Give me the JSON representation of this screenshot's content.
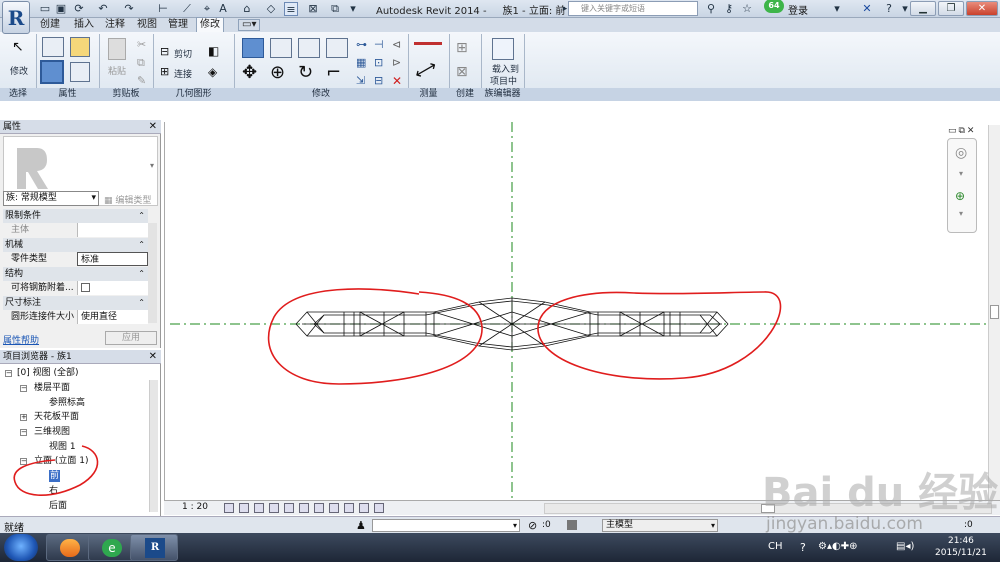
{
  "titlebar": {
    "app_letter": "R",
    "app_title": "Autodesk Revit 2014 -",
    "doc_title": "族1 - 立面: 前",
    "search_placeholder": "键入关键字或短语",
    "badge_count": "64",
    "login": "登录"
  },
  "ribbon": {
    "tabs": [
      {
        "label": "创建",
        "active": false
      },
      {
        "label": "插入",
        "active": false
      },
      {
        "label": "注释",
        "active": false
      },
      {
        "label": "视图",
        "active": false
      },
      {
        "label": "管理",
        "active": false
      },
      {
        "label": "修改",
        "active": true
      }
    ],
    "buttons": {
      "modify": "修改",
      "paste": "粘贴",
      "cut": "剪切",
      "join": "连接",
      "load_project_1": "载入到",
      "load_project_2": "项目中"
    },
    "groups": [
      "选择",
      "属性",
      "剪贴板",
      "几何图形",
      "修改",
      "测量",
      "创建",
      "族编辑器"
    ]
  },
  "properties": {
    "title": "属性",
    "type_selector": "族: 常规模型",
    "edit_type": "编辑类型",
    "rows": [
      {
        "kind": "cat",
        "label": "限制条件"
      },
      {
        "kind": "row",
        "label": "主体",
        "value": ""
      },
      {
        "kind": "cat",
        "label": "机械"
      },
      {
        "kind": "row",
        "label": "零件类型",
        "value": "标准"
      },
      {
        "kind": "cat",
        "label": "结构"
      },
      {
        "kind": "row",
        "label": "可将钢筋附着...",
        "value": ""
      },
      {
        "kind": "cat",
        "label": "尺寸标注"
      },
      {
        "kind": "row",
        "label": "圆形连接件大小",
        "value": "使用直径"
      }
    ],
    "help_link": "属性帮助",
    "apply": "应用"
  },
  "browser": {
    "title": "项目浏览器 - 族1",
    "root": "[0] 视图 (全部)",
    "floor_plans": "楼层平面",
    "ref_level": "参照标高",
    "ceiling_plans": "天花板平面",
    "views_3d": "三维视图",
    "view1": "视图 1",
    "elevations": "立面 (立面 1)",
    "front": "前",
    "right": "右",
    "back": "后面"
  },
  "view_bar": {
    "scale": "1 : 20"
  },
  "status_bar": {
    "text": "就绪",
    "count": ":0",
    "model": "主模型",
    "trailing": ":0"
  },
  "taskbar": {
    "time": "21:46",
    "date": "2015/11/21",
    "lang": "CH"
  },
  "watermark": {
    "logo": "Bai du 经验",
    "url": "jingyan.baidu.com"
  },
  "colors": {
    "annotation_red": "#e01d1d",
    "ref_plane_green": "#1e8a1e",
    "ribbon_bg": "#dde6f0",
    "selected_blue": "#3b6fc7"
  },
  "icons": [
    "revit-app-icon",
    "open-icon",
    "save-icon",
    "undo-icon",
    "redo-icon",
    "search-icon",
    "help-icon",
    "close-icon",
    "minimize-icon",
    "maximize-icon",
    "windows-start-icon"
  ]
}
